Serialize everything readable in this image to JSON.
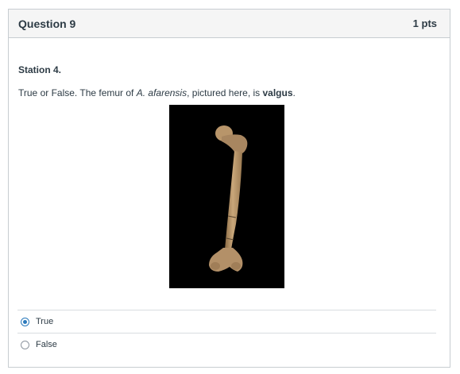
{
  "question": {
    "title": "Question 9",
    "points": "1 pts",
    "station": "Station 4.",
    "prompt": {
      "before": "True or False. The femur of ",
      "species": "A. afarensis",
      "middle": ", pictured here, is ",
      "term": "valgus",
      "after": "."
    }
  },
  "image": {
    "subject": "femur-bone"
  },
  "answers": [
    {
      "label": "True",
      "selected": true
    },
    {
      "label": "False",
      "selected": false
    }
  ],
  "colors": {
    "accent": "#2b7abc",
    "header_bg": "#f5f5f5",
    "border": "#c7cdd1",
    "text": "#2d3b45"
  }
}
